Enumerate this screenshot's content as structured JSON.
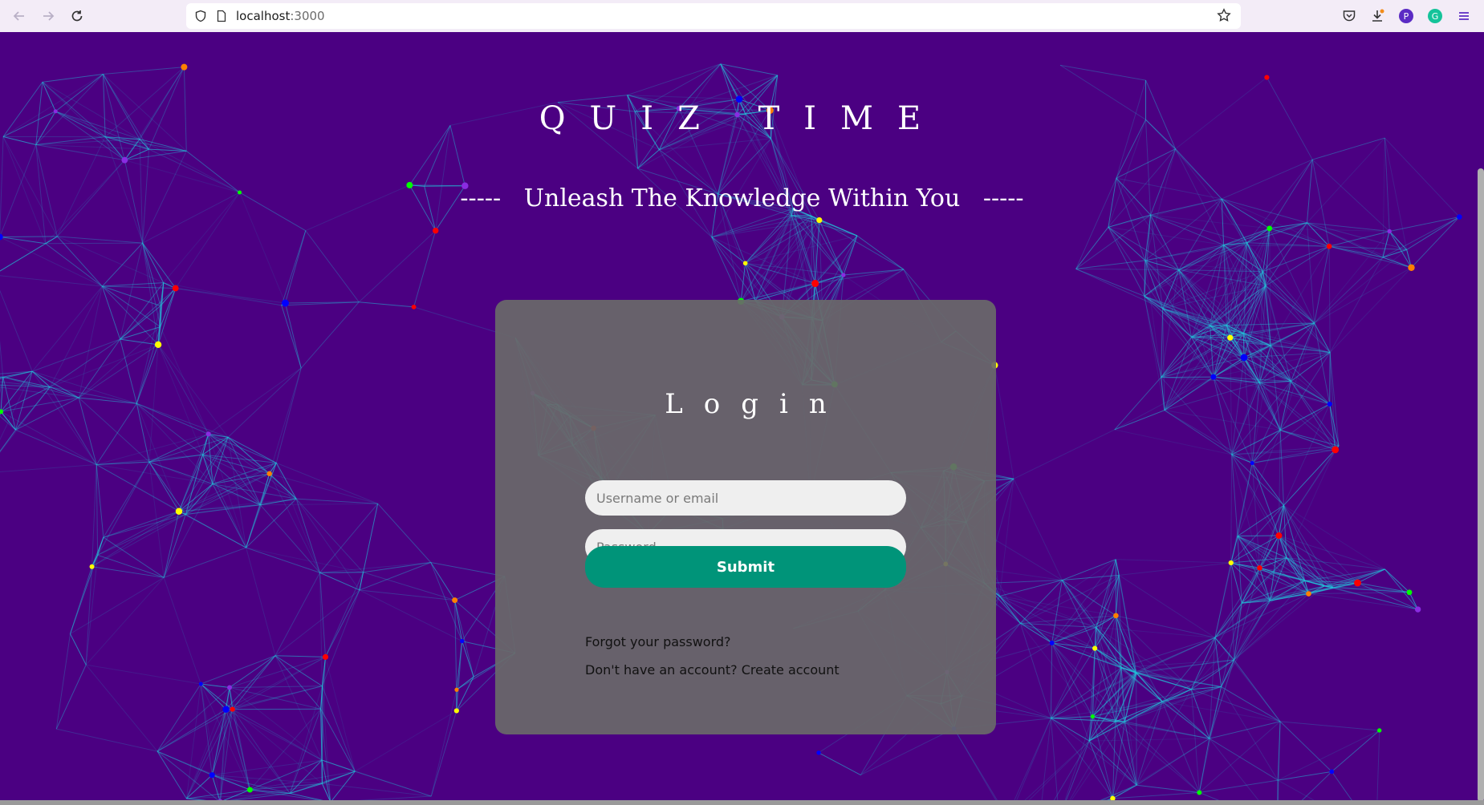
{
  "browser": {
    "url_host": "localhost",
    "url_port": ":3000",
    "icons": [
      "back-icon",
      "forward-icon",
      "reload-icon",
      "shield-icon",
      "page-icon",
      "bookmark-star-icon",
      "pocket-icon",
      "download-icon",
      "profile-icon",
      "grammarly-icon",
      "menu-icon"
    ],
    "profile_letter": "P",
    "extension_letter": "G"
  },
  "page": {
    "title": "QUIZ TIME",
    "subtitle": "-----   Unleash The Knowledge Within You   -----"
  },
  "login": {
    "heading": "Login",
    "username_placeholder": "Username or email",
    "password_placeholder": "Password",
    "submit_label": "Submit",
    "forgot_label": "Forgot your password?",
    "no_account_text": "Don't have an account? ",
    "create_label": "Create account"
  },
  "colors": {
    "background": "#4b0082",
    "card": "#696969",
    "submit": "#009479",
    "lines": "#22c3d9",
    "dot_colors": [
      "#ff7f00",
      "#ffff00",
      "#00ff00",
      "#ff0000",
      "#0000ff",
      "#8a2be2"
    ]
  }
}
